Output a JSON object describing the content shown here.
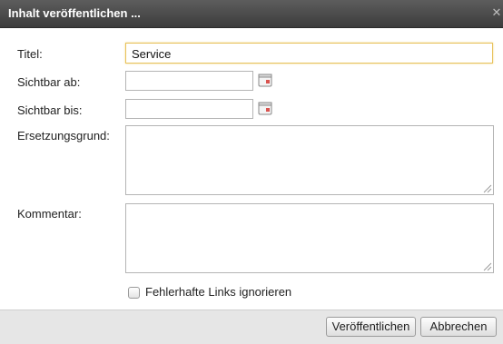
{
  "dialog": {
    "title": "Inhalt veröffentlichen ...",
    "close_glyph": "✕"
  },
  "form": {
    "titel_label": "Titel:",
    "titel_value": "Service",
    "sichtbar_ab_label": "Sichtbar ab:",
    "sichtbar_ab_value": "",
    "sichtbar_bis_label": "Sichtbar bis:",
    "sichtbar_bis_value": "",
    "ersetzungsgrund_label": "Ersetzungsgrund:",
    "kommentar_label": "Kommentar:",
    "ignore_links_label": "Fehlerhafte Links ignorieren",
    "ignore_links_checked": false
  },
  "buttons": {
    "publish": "Veröffentlichen",
    "cancel": "Abbrechen"
  },
  "colors": {
    "titlebar": "#4a4a4a",
    "focus_border": "#e7c15a",
    "footer": "#e6e6e6"
  },
  "icons": [
    "calendar-icon",
    "resize-grip-icon",
    "close-icon"
  ]
}
